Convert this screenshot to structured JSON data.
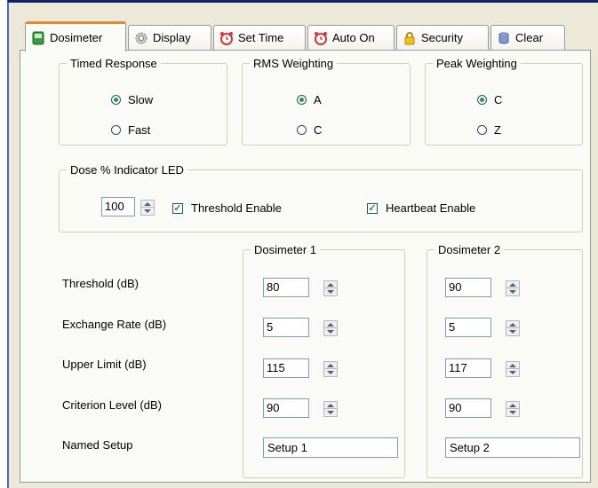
{
  "tabs": [
    {
      "label": "Dosimeter",
      "icon": "dosimeter-icon",
      "active": true
    },
    {
      "label": "Display",
      "icon": "gear-icon"
    },
    {
      "label": "Set Time",
      "icon": "alarm-clock-icon"
    },
    {
      "label": "Auto On",
      "icon": "alarm-clock-icon"
    },
    {
      "label": "Security",
      "icon": "lock-icon"
    },
    {
      "label": "Clear",
      "icon": "database-icon"
    }
  ],
  "timed_response": {
    "title": "Timed Response",
    "options": [
      "Slow",
      "Fast"
    ],
    "selected": "Slow"
  },
  "rms_weighting": {
    "title": "RMS Weighting",
    "options": [
      "A",
      "C"
    ],
    "selected": "A"
  },
  "peak_weighting": {
    "title": "Peak Weighting",
    "options": [
      "C",
      "Z"
    ],
    "selected": "C"
  },
  "dose_led": {
    "title": "Dose % Indicator LED",
    "value": "100",
    "threshold_enable": {
      "label": "Threshold Enable",
      "checked": true
    },
    "heartbeat_enable": {
      "label": "Heartbeat Enable",
      "checked": true
    }
  },
  "dosimeter1": {
    "title": "Dosimeter 1",
    "threshold": "80",
    "exchange_rate": "5",
    "upper_limit": "115",
    "criterion_level": "90",
    "named_setup": "Setup 1"
  },
  "dosimeter2": {
    "title": "Dosimeter 2",
    "threshold": "90",
    "exchange_rate": "5",
    "upper_limit": "117",
    "criterion_level": "90",
    "named_setup": "Setup 2"
  },
  "row_labels": {
    "threshold": "Threshold (dB)",
    "exchange_rate": "Exchange Rate (dB)",
    "upper_limit": "Upper Limit (dB)",
    "criterion_level": "Criterion Level (dB)",
    "named_setup": "Named Setup"
  },
  "colors": {
    "active_tab_accent": "#e68b2c",
    "window_frame": "#0a246a",
    "radio_check": "#21a121"
  }
}
